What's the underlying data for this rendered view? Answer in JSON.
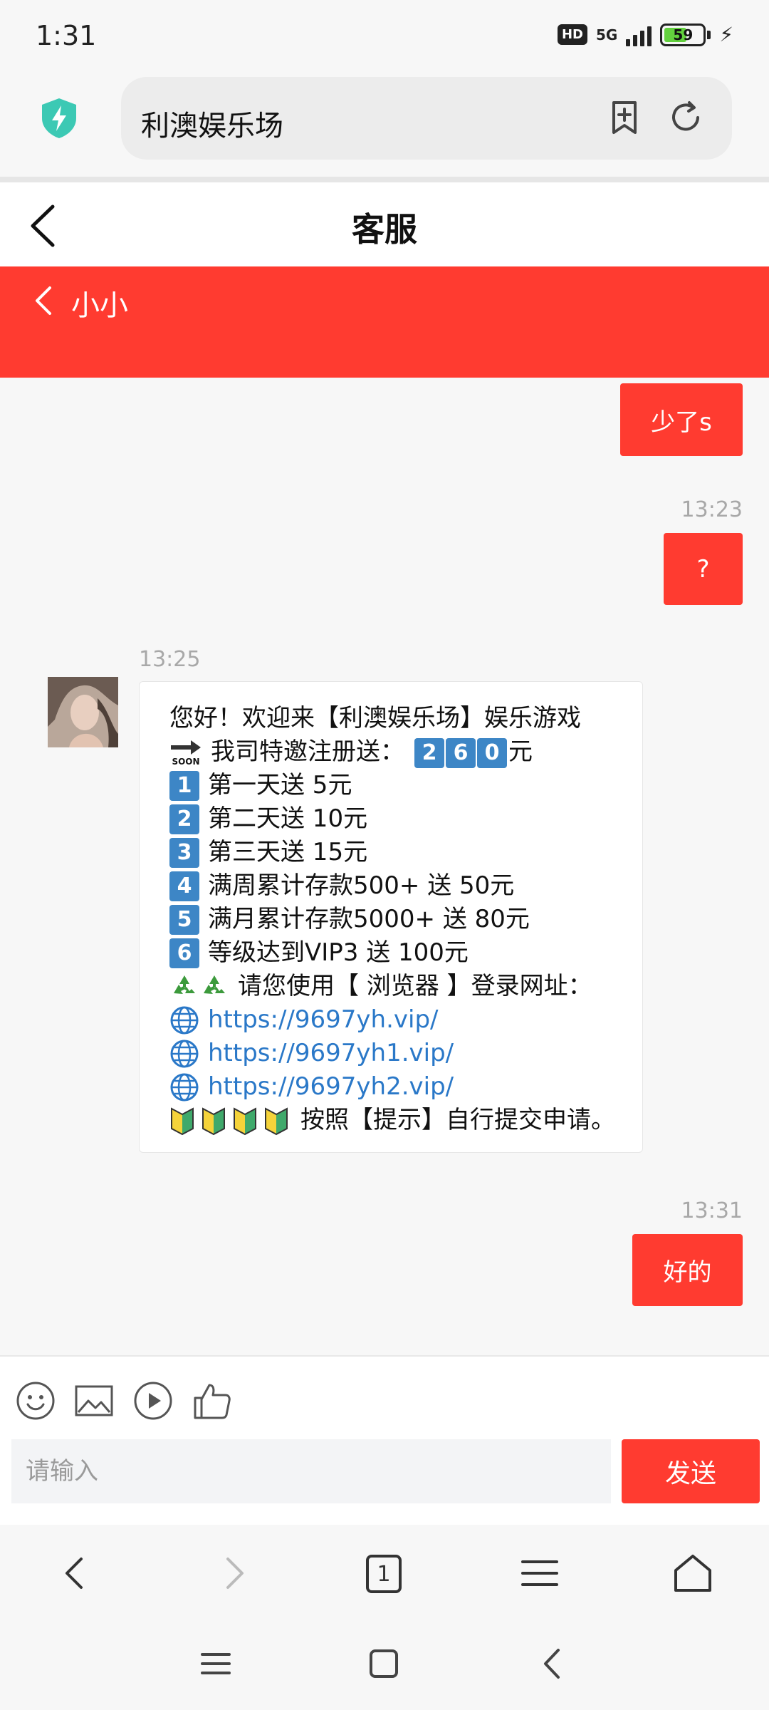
{
  "status": {
    "time": "1:31",
    "hd": "HD",
    "network": "5G",
    "battery": "59",
    "battery_level": 0.59
  },
  "browser": {
    "address": "利澳娱乐场",
    "tab_count": "1"
  },
  "page": {
    "title": "客服"
  },
  "chat": {
    "contact_name": "小小",
    "messages": [
      {
        "side": "out",
        "text": "少了s"
      },
      {
        "side": "out",
        "time": "13:23",
        "text": "?"
      },
      {
        "side": "in",
        "time": "13:25",
        "lines": [
          "您好！欢迎来【利澳娱乐场】娱乐游戏",
          "我司特邀注册送：",
          "元",
          "第一天送 5元",
          "第二天送 10元",
          "第三天送 15元",
          "满周累计存款500+ 送 50元",
          "满月累计存款5000+ 送 80元",
          "等级达到VIP3 送 100元",
          "请您使用【 浏览器 】登录网址：",
          "https://9697yh.vip/",
          "https://9697yh1.vip/",
          "https://9697yh2.vip/",
          "按照【提示】自行提交申请。"
        ],
        "amount_digits": [
          "2",
          "6",
          "0"
        ],
        "list_numbers": [
          "1",
          "2",
          "3",
          "4",
          "5",
          "6"
        ],
        "soon_label": "SOON"
      },
      {
        "side": "out",
        "time": "13:31",
        "text": "好的"
      }
    ]
  },
  "input": {
    "placeholder": "请输入",
    "send_label": "发送"
  },
  "colors": {
    "accent": "#ff3b30",
    "link": "#2a78c8",
    "keycap": "#3d86c6"
  }
}
